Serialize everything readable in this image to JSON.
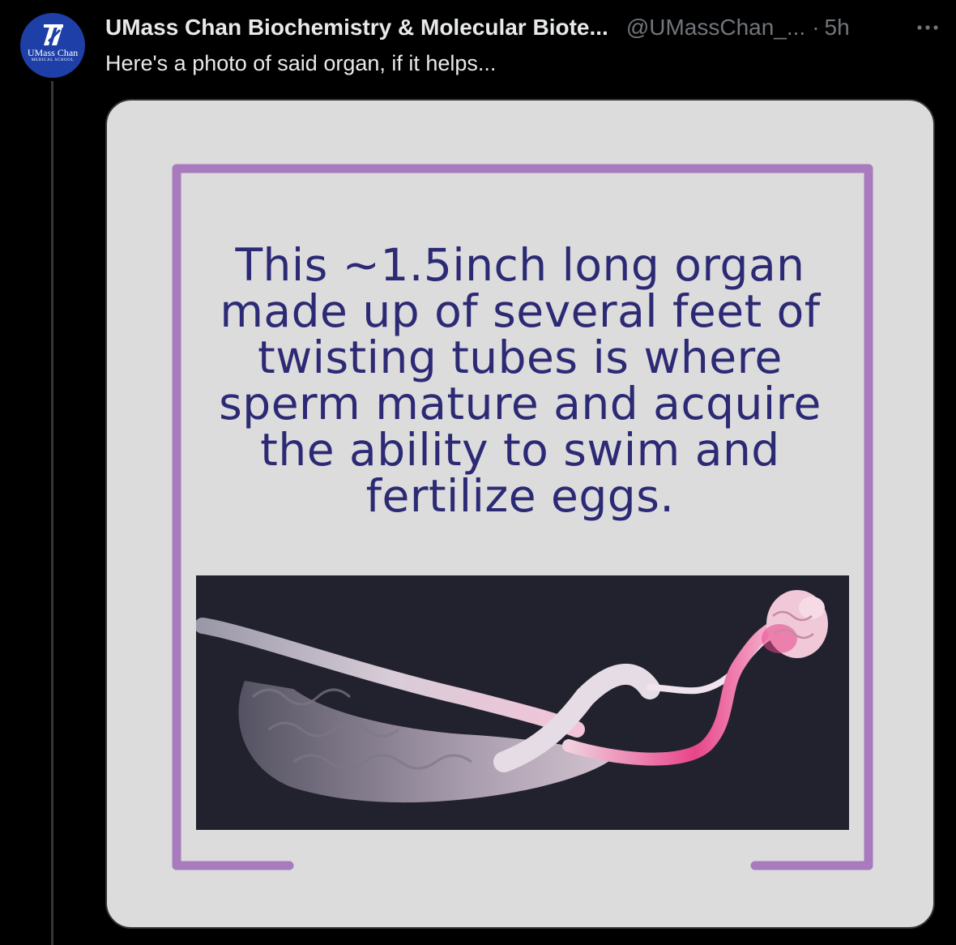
{
  "tweet": {
    "display_name": "UMass Chan Biochemistry & Molecular Biote...",
    "handle": "@UMassChan_...",
    "separator": "·",
    "time": "5h",
    "text": "Here's a photo of said organ, if it helps..."
  },
  "avatar": {
    "name_line": "UMass Chan",
    "sub_line": "MEDICAL SCHOOL"
  },
  "media": {
    "caption": "This ~1.5inch long organ\nmade up of several feet of\ntwisting tubes is where\nsperm mature and acquire\nthe ability to swim and\nfertilize eggs."
  },
  "colors": {
    "background": "#000000",
    "primary_text": "#e7e9ea",
    "secondary_text": "#71767b",
    "avatar_bg": "#1d3fa7",
    "card_bg": "#dcdcdc",
    "frame_purple": "#a77bbd",
    "caption_text": "#2c2a75",
    "micrograph_bg": "#22222f",
    "tissue_pink": "#e8458a"
  },
  "icons": {
    "more": "more-horizontal-icon",
    "avatar_mark": "umass-logo-icon"
  }
}
